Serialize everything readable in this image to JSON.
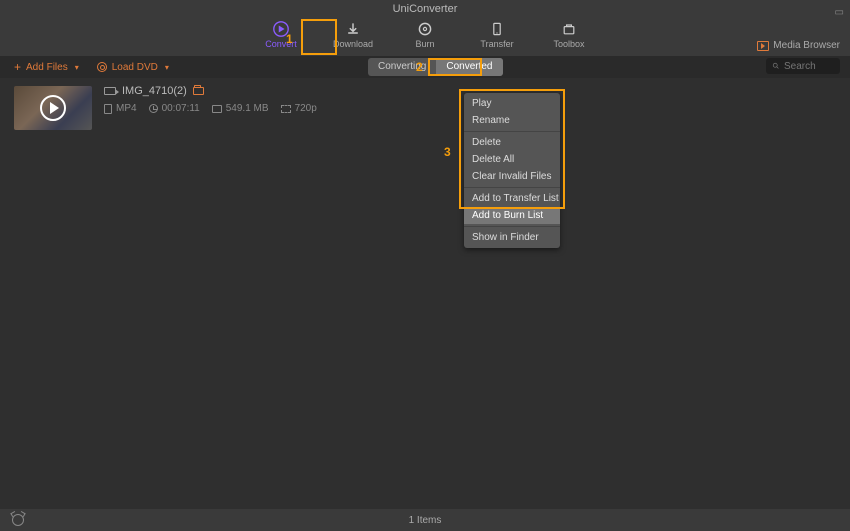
{
  "app": {
    "title": "UniConverter"
  },
  "toolbar": {
    "convert": "Convert",
    "download": "Download",
    "burn": "Burn",
    "transfer": "Transfer",
    "toolbox": "Toolbox",
    "media_browser": "Media Browser"
  },
  "actions": {
    "add_files": "Add Files",
    "load_dvd": "Load DVD"
  },
  "tabs": {
    "converting": "Converting",
    "converted": "Converted"
  },
  "search": {
    "placeholder": "Search"
  },
  "file": {
    "name": "IMG_4710(2)",
    "format": "MP4",
    "duration": "00:07:11",
    "size": "549.1 MB",
    "resolution": "720p"
  },
  "context_menu": {
    "play": "Play",
    "rename": "Rename",
    "delete": "Delete",
    "delete_all": "Delete All",
    "clear_invalid": "Clear Invalid Files",
    "add_transfer": "Add to Transfer List",
    "add_burn": "Add to Burn List",
    "show_finder": "Show in Finder"
  },
  "status": {
    "count": "1 Items"
  },
  "annotations": {
    "n1": "1",
    "n2": "2",
    "n3": "3"
  }
}
